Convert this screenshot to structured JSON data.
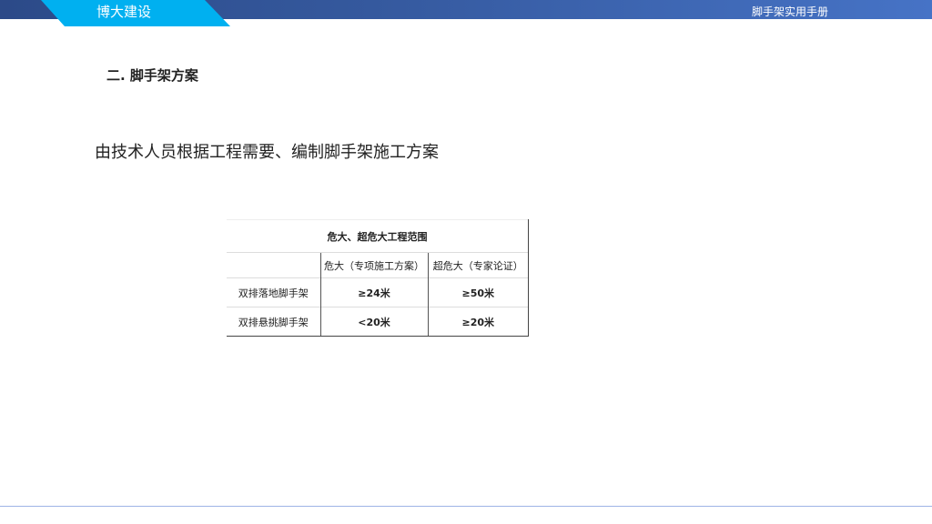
{
  "header": {
    "brand": "博大建设",
    "manual_title": "脚手架实用手册"
  },
  "section_title": "二. 脚手架方案",
  "description": "由技术人员根据工程需要、编制脚手架施工方案",
  "table": {
    "title": "危大、超危大工程范围",
    "columns": [
      "",
      "危大（专项施工方案）",
      "超危大（专家论证）"
    ],
    "rows": [
      {
        "type": "双排落地脚手架",
        "danger": "≥24米",
        "super_danger": "≥50米"
      },
      {
        "type": "双排悬挑脚手架",
        "danger": "<20米",
        "super_danger": "≥20米"
      }
    ]
  },
  "colors": {
    "cyan": "#00b0f0",
    "header_blue": "#35599e"
  }
}
